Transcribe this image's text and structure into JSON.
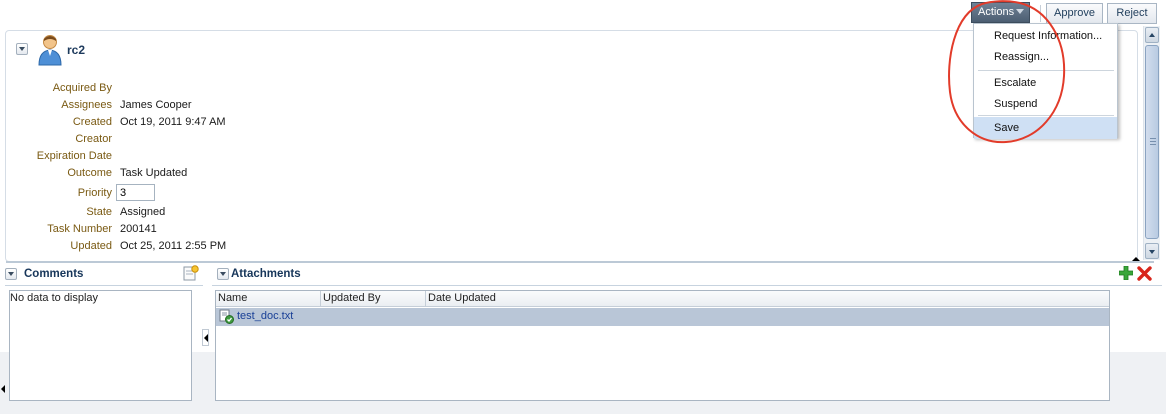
{
  "toolbar": {
    "actions_label": "Actions",
    "approve_label": "Approve",
    "reject_label": "Reject"
  },
  "actions_menu": {
    "items": [
      "Request Information...",
      "Reassign...",
      "Escalate",
      "Suspend",
      "Save"
    ],
    "highlighted": "Save"
  },
  "details": {
    "title": "rc2",
    "fields": [
      {
        "label": "Acquired By",
        "value": ""
      },
      {
        "label": "Assignees",
        "value": "James Cooper"
      },
      {
        "label": "Created",
        "value": "Oct 19, 2011 9:47 AM"
      },
      {
        "label": "Creator",
        "value": ""
      },
      {
        "label": "Expiration Date",
        "value": ""
      },
      {
        "label": "Outcome",
        "value": "Task Updated"
      },
      {
        "label": "Priority",
        "value": "3"
      },
      {
        "label": "State",
        "value": "Assigned"
      },
      {
        "label": "Task Number",
        "value": "200141"
      },
      {
        "label": "Updated",
        "value": "Oct 25, 2011 2:55 PM"
      }
    ]
  },
  "comments": {
    "title": "Comments",
    "empty_text": "No data to display"
  },
  "attachments": {
    "title": "Attachments",
    "columns": [
      "Name",
      "Updated By",
      "Date Updated"
    ],
    "rows": [
      {
        "name": "test_doc.txt",
        "updated_by": "",
        "date_updated": ""
      }
    ]
  },
  "colors": {
    "accent_red": "#e23b2a",
    "selection": "#b9c6d7",
    "label": "#7a5a13",
    "title": "#17365a"
  },
  "icons": [
    "user-icon",
    "add-note-icon",
    "add-icon",
    "delete-icon",
    "text-doc-icon",
    "collapse-icon",
    "chevron-down-icon"
  ]
}
